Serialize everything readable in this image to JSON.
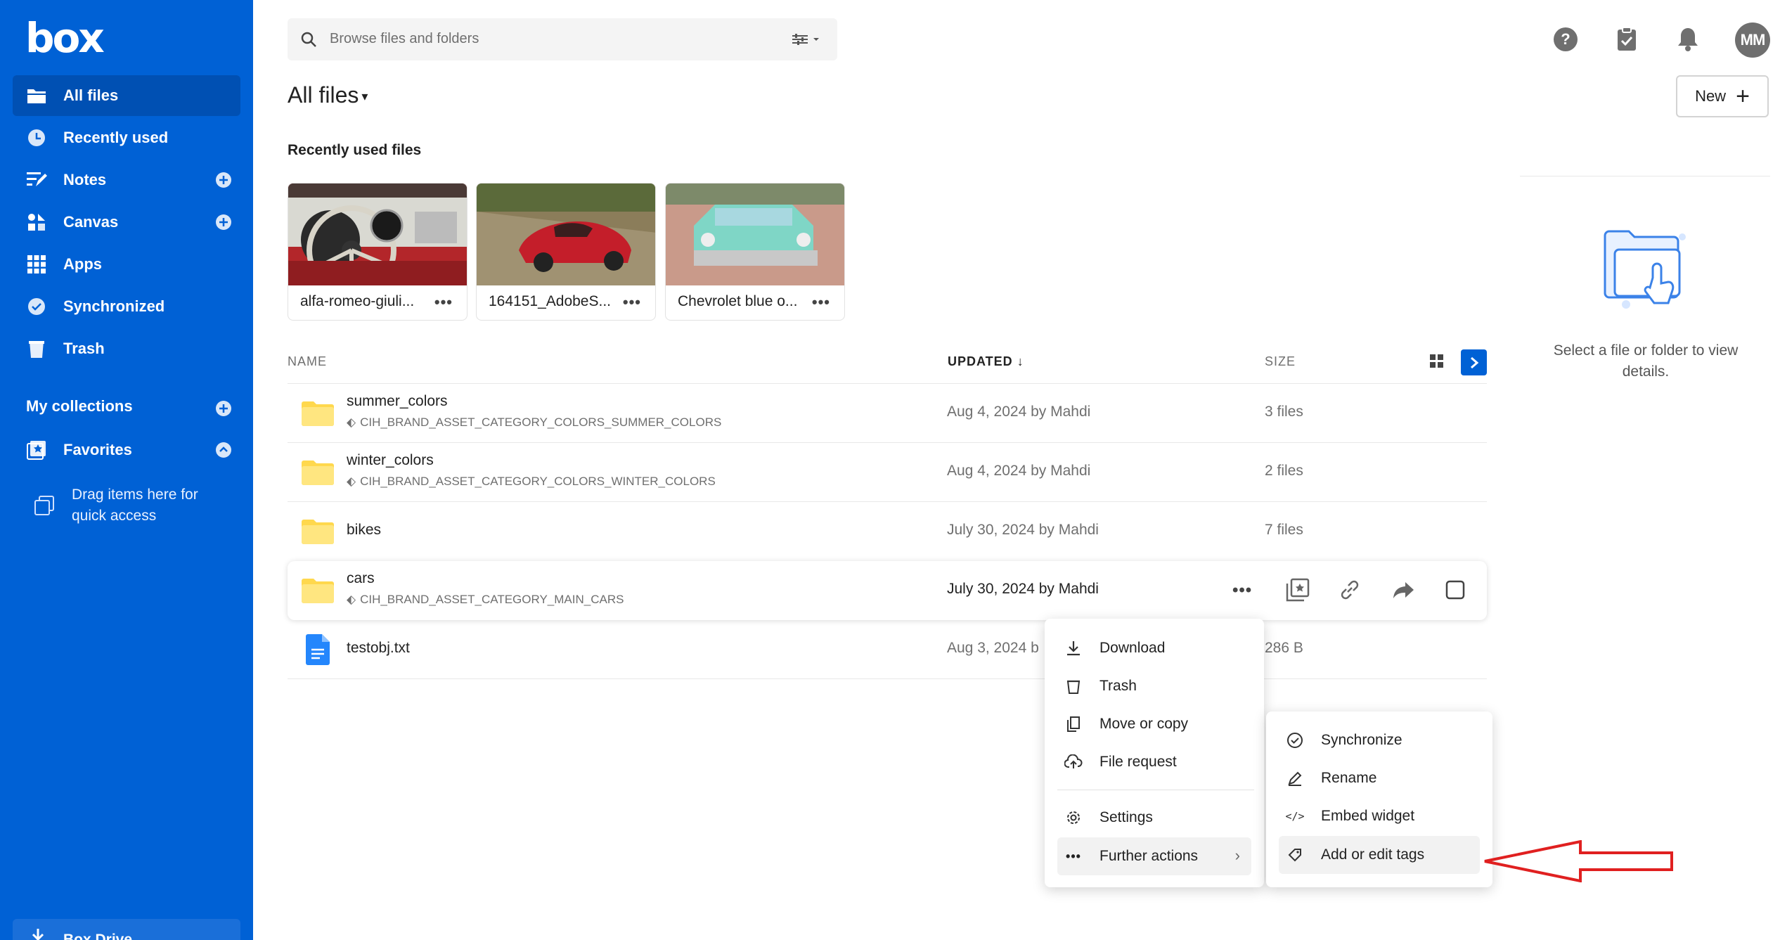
{
  "sidebar": {
    "logo": "box",
    "items": [
      {
        "label": "All files",
        "icon": "folder-icon",
        "active": true
      },
      {
        "label": "Recently used",
        "icon": "clock-icon"
      },
      {
        "label": "Notes",
        "icon": "notes-icon"
      },
      {
        "label": "Canvas",
        "icon": "canvas-icon"
      },
      {
        "label": "Apps",
        "icon": "apps-grid-icon"
      },
      {
        "label": "Synchronized",
        "icon": "check-circle-icon"
      },
      {
        "label": "Trash",
        "icon": "trash-icon"
      }
    ],
    "collections_title": "My collections",
    "favorites": "Favorites",
    "drag_hint": "Drag items here for quick access",
    "drive": "Box Drive"
  },
  "search": {
    "placeholder": "Browse files and folders"
  },
  "user": {
    "initials": "MM"
  },
  "header": {
    "title": "All files",
    "new_label": "New"
  },
  "recent": {
    "title": "Recently used files",
    "cards": [
      {
        "name": "alfa-romeo-giuli...",
        "dots": "•••"
      },
      {
        "name": "164151_AdobeS...",
        "dots": "•••"
      },
      {
        "name": "Chevrolet blue o...",
        "dots": "•••"
      }
    ]
  },
  "table": {
    "headers": {
      "name": "NAME",
      "updated": "UPDATED",
      "size": "SIZE"
    },
    "rows": [
      {
        "name": "summer_colors",
        "tag": "CIH_BRAND_ASSET_CATEGORY_COLORS_SUMMER_COLORS",
        "updated": "Aug 4, 2024 by Mahdi",
        "size": "3 files"
      },
      {
        "name": "winter_colors",
        "tag": "CIH_BRAND_ASSET_CATEGORY_COLORS_WINTER_COLORS",
        "updated": "Aug 4, 2024 by Mahdi",
        "size": "2 files"
      },
      {
        "name": "bikes",
        "tag": "",
        "updated": "July 30, 2024 by Mahdi",
        "size": "7 files"
      },
      {
        "name": "cars",
        "tag": "CIH_BRAND_ASSET_CATEGORY_MAIN_CARS",
        "updated": "July 30, 2024 by Mahdi",
        "size": ""
      },
      {
        "name": "testobj.txt",
        "tag": "",
        "updated": "Aug 3, 2024 b",
        "size": "286 B"
      }
    ]
  },
  "details": {
    "empty_text": "Select a file or folder to view details."
  },
  "context_menu": {
    "items": [
      "Download",
      "Trash",
      "Move or copy",
      "File request",
      "Settings",
      "Further actions"
    ]
  },
  "submenu": {
    "items": [
      "Synchronize",
      "Rename",
      "Embed widget",
      "Add or edit tags"
    ]
  },
  "colors": {
    "brand": "#0061d5",
    "folder": "#ffd84d",
    "annotation": "#e02020"
  }
}
